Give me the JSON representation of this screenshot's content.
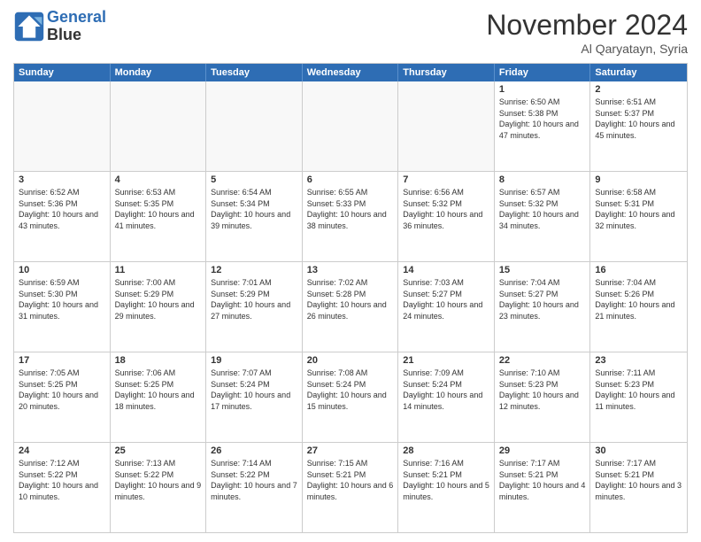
{
  "header": {
    "logo_line1": "General",
    "logo_line2": "Blue",
    "month": "November 2024",
    "location": "Al Qaryatayn, Syria"
  },
  "days_of_week": [
    "Sunday",
    "Monday",
    "Tuesday",
    "Wednesday",
    "Thursday",
    "Friday",
    "Saturday"
  ],
  "weeks": [
    [
      {
        "day": "",
        "info": "",
        "empty": true
      },
      {
        "day": "",
        "info": "",
        "empty": true
      },
      {
        "day": "",
        "info": "",
        "empty": true
      },
      {
        "day": "",
        "info": "",
        "empty": true
      },
      {
        "day": "",
        "info": "",
        "empty": true
      },
      {
        "day": "1",
        "info": "Sunrise: 6:50 AM\nSunset: 5:38 PM\nDaylight: 10 hours and 47 minutes."
      },
      {
        "day": "2",
        "info": "Sunrise: 6:51 AM\nSunset: 5:37 PM\nDaylight: 10 hours and 45 minutes."
      }
    ],
    [
      {
        "day": "3",
        "info": "Sunrise: 6:52 AM\nSunset: 5:36 PM\nDaylight: 10 hours and 43 minutes."
      },
      {
        "day": "4",
        "info": "Sunrise: 6:53 AM\nSunset: 5:35 PM\nDaylight: 10 hours and 41 minutes."
      },
      {
        "day": "5",
        "info": "Sunrise: 6:54 AM\nSunset: 5:34 PM\nDaylight: 10 hours and 39 minutes."
      },
      {
        "day": "6",
        "info": "Sunrise: 6:55 AM\nSunset: 5:33 PM\nDaylight: 10 hours and 38 minutes."
      },
      {
        "day": "7",
        "info": "Sunrise: 6:56 AM\nSunset: 5:32 PM\nDaylight: 10 hours and 36 minutes."
      },
      {
        "day": "8",
        "info": "Sunrise: 6:57 AM\nSunset: 5:32 PM\nDaylight: 10 hours and 34 minutes."
      },
      {
        "day": "9",
        "info": "Sunrise: 6:58 AM\nSunset: 5:31 PM\nDaylight: 10 hours and 32 minutes."
      }
    ],
    [
      {
        "day": "10",
        "info": "Sunrise: 6:59 AM\nSunset: 5:30 PM\nDaylight: 10 hours and 31 minutes."
      },
      {
        "day": "11",
        "info": "Sunrise: 7:00 AM\nSunset: 5:29 PM\nDaylight: 10 hours and 29 minutes."
      },
      {
        "day": "12",
        "info": "Sunrise: 7:01 AM\nSunset: 5:29 PM\nDaylight: 10 hours and 27 minutes."
      },
      {
        "day": "13",
        "info": "Sunrise: 7:02 AM\nSunset: 5:28 PM\nDaylight: 10 hours and 26 minutes."
      },
      {
        "day": "14",
        "info": "Sunrise: 7:03 AM\nSunset: 5:27 PM\nDaylight: 10 hours and 24 minutes."
      },
      {
        "day": "15",
        "info": "Sunrise: 7:04 AM\nSunset: 5:27 PM\nDaylight: 10 hours and 23 minutes."
      },
      {
        "day": "16",
        "info": "Sunrise: 7:04 AM\nSunset: 5:26 PM\nDaylight: 10 hours and 21 minutes."
      }
    ],
    [
      {
        "day": "17",
        "info": "Sunrise: 7:05 AM\nSunset: 5:25 PM\nDaylight: 10 hours and 20 minutes."
      },
      {
        "day": "18",
        "info": "Sunrise: 7:06 AM\nSunset: 5:25 PM\nDaylight: 10 hours and 18 minutes."
      },
      {
        "day": "19",
        "info": "Sunrise: 7:07 AM\nSunset: 5:24 PM\nDaylight: 10 hours and 17 minutes."
      },
      {
        "day": "20",
        "info": "Sunrise: 7:08 AM\nSunset: 5:24 PM\nDaylight: 10 hours and 15 minutes."
      },
      {
        "day": "21",
        "info": "Sunrise: 7:09 AM\nSunset: 5:24 PM\nDaylight: 10 hours and 14 minutes."
      },
      {
        "day": "22",
        "info": "Sunrise: 7:10 AM\nSunset: 5:23 PM\nDaylight: 10 hours and 12 minutes."
      },
      {
        "day": "23",
        "info": "Sunrise: 7:11 AM\nSunset: 5:23 PM\nDaylight: 10 hours and 11 minutes."
      }
    ],
    [
      {
        "day": "24",
        "info": "Sunrise: 7:12 AM\nSunset: 5:22 PM\nDaylight: 10 hours and 10 minutes."
      },
      {
        "day": "25",
        "info": "Sunrise: 7:13 AM\nSunset: 5:22 PM\nDaylight: 10 hours and 9 minutes."
      },
      {
        "day": "26",
        "info": "Sunrise: 7:14 AM\nSunset: 5:22 PM\nDaylight: 10 hours and 7 minutes."
      },
      {
        "day": "27",
        "info": "Sunrise: 7:15 AM\nSunset: 5:21 PM\nDaylight: 10 hours and 6 minutes."
      },
      {
        "day": "28",
        "info": "Sunrise: 7:16 AM\nSunset: 5:21 PM\nDaylight: 10 hours and 5 minutes."
      },
      {
        "day": "29",
        "info": "Sunrise: 7:17 AM\nSunset: 5:21 PM\nDaylight: 10 hours and 4 minutes."
      },
      {
        "day": "30",
        "info": "Sunrise: 7:17 AM\nSunset: 5:21 PM\nDaylight: 10 hours and 3 minutes."
      }
    ]
  ]
}
